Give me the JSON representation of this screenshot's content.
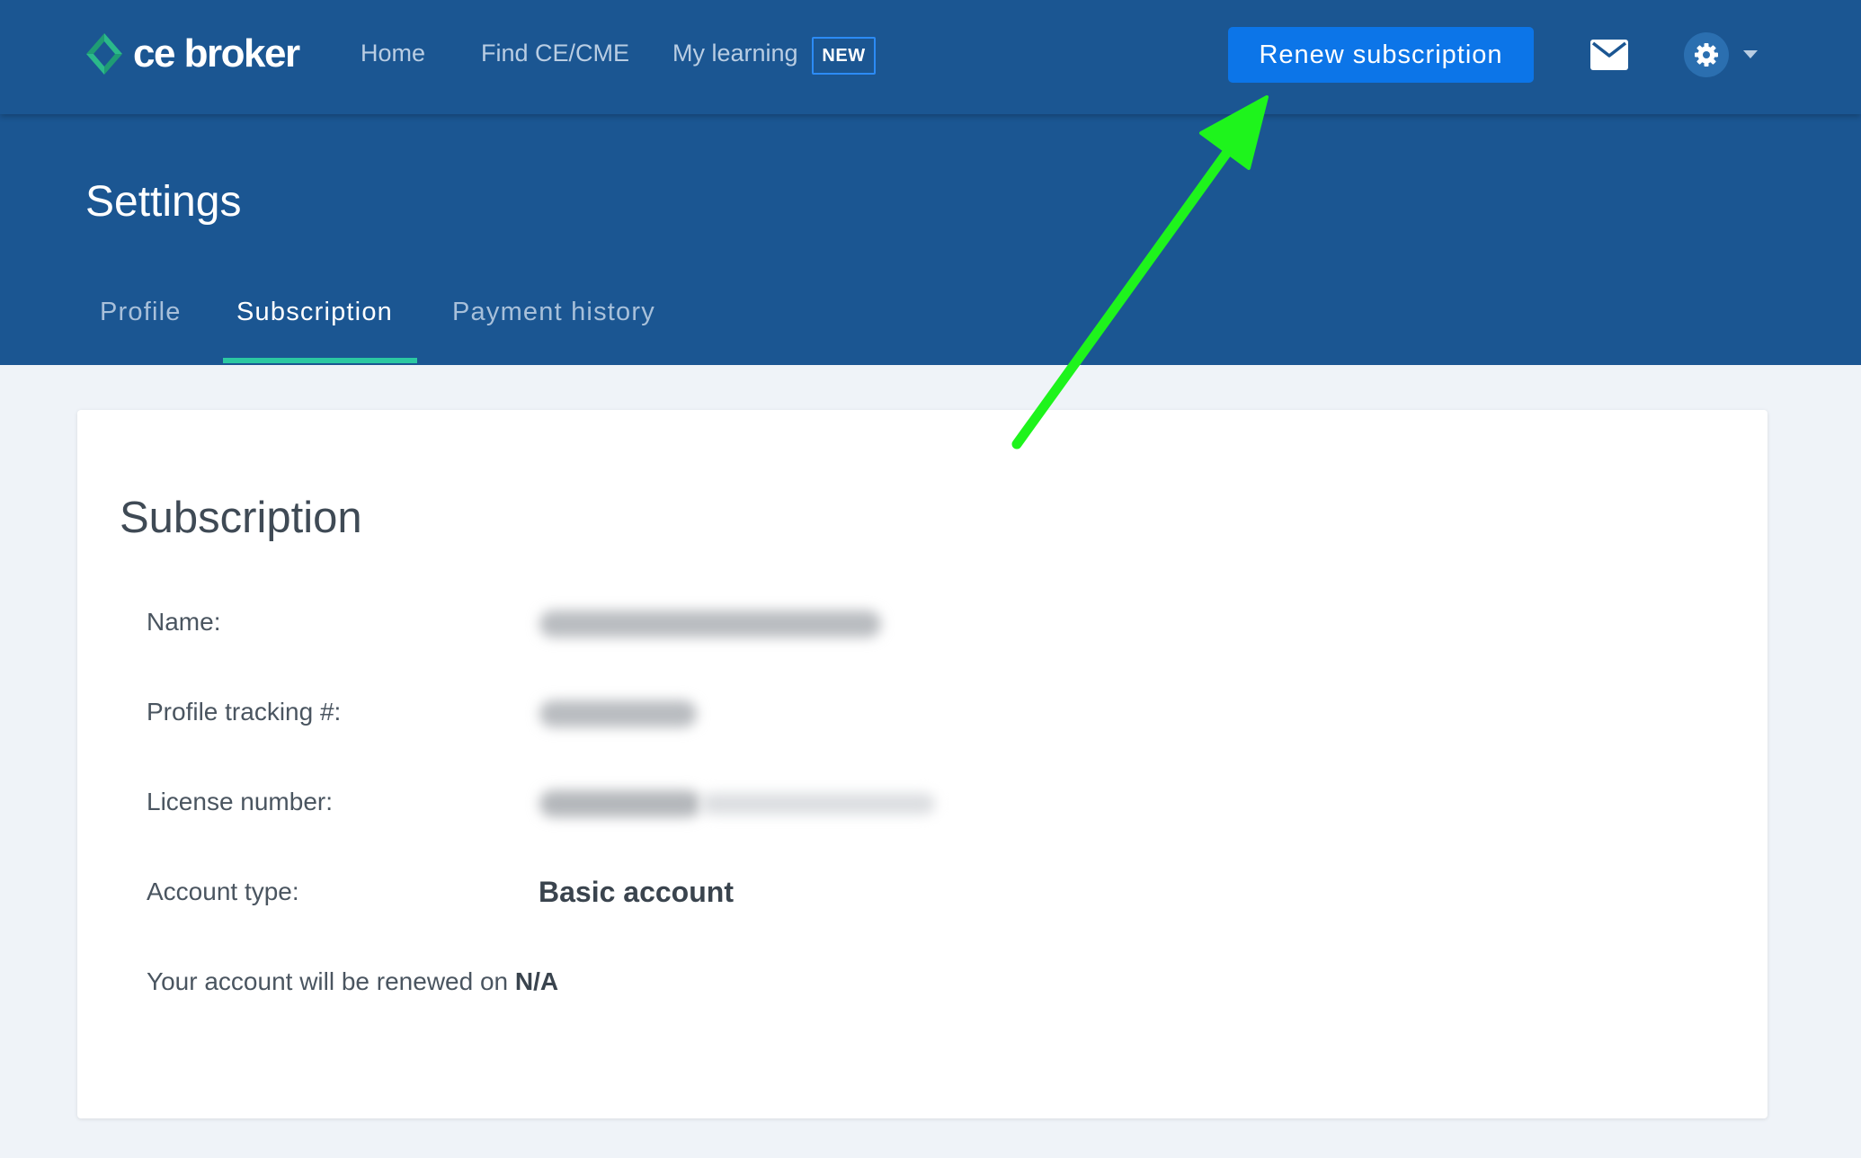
{
  "nav": {
    "logo_text": "ce broker",
    "links": [
      {
        "label": "Home"
      },
      {
        "label": "Find CE/CME"
      },
      {
        "label": "My learning"
      }
    ],
    "new_badge": "NEW",
    "renew_button": "Renew subscription",
    "icons": [
      "logo-diamond-icon",
      "mail-icon",
      "gear-icon",
      "caret-down-icon"
    ]
  },
  "header": {
    "title": "Settings",
    "tabs": [
      {
        "label": "Profile",
        "active": false
      },
      {
        "label": "Subscription",
        "active": true
      },
      {
        "label": "Payment history",
        "active": false
      }
    ]
  },
  "subscription": {
    "title": "Subscription",
    "rows": [
      {
        "label": "Name:"
      },
      {
        "label": "Profile tracking #:"
      },
      {
        "label": "License number:"
      },
      {
        "label": "Account type:",
        "value": "Basic account"
      }
    ],
    "renew_text": "Your account will be renewed on",
    "renew_date": "N/A"
  },
  "colors": {
    "nav_bg": "#1b5692",
    "page_bg": "#eff3f8",
    "primary_button": "#0c75e8",
    "tab_active_underline": "#2bc8a2",
    "annotation_arrow": "#1ef41c",
    "logo_green": "#2bb98a"
  }
}
